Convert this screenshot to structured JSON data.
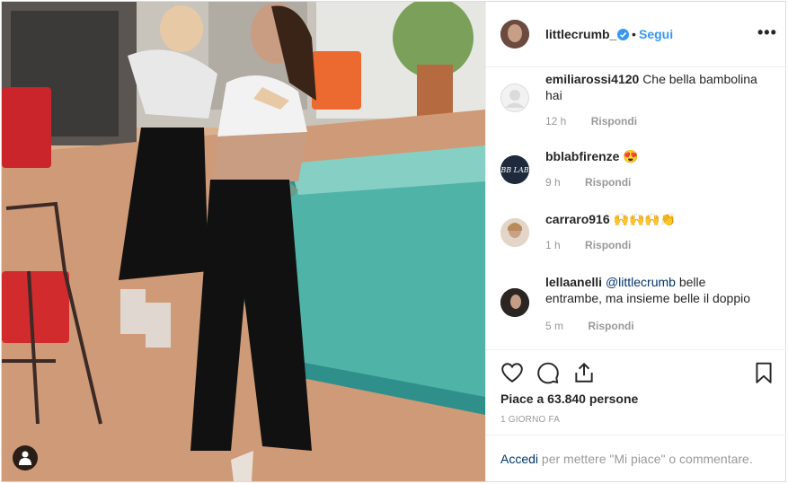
{
  "header": {
    "username": "littlecrumb_",
    "follow_label": "Segui",
    "dot": "•",
    "more_label": "•••"
  },
  "comments": [
    {
      "user": "emiliarossi4120",
      "text": "Che bella bambolina hai",
      "time": "12 h",
      "reply": "Rispondi"
    },
    {
      "user": "bblabfirenze",
      "text": "😍",
      "time": "9 h",
      "reply": "Rispondi"
    },
    {
      "user": "carraro916",
      "text": "🙌🙌🙌👏",
      "time": "1 h",
      "reply": "Rispondi"
    },
    {
      "user": "lellaanelli",
      "mention": "@littlecrumb",
      "text": " belle entrambe, ma insieme belle il doppio",
      "time": "5 m",
      "reply": "Rispondi"
    }
  ],
  "likes": "Piace a 63.840 persone",
  "posted_ago": "1 GIORNO FA",
  "login": {
    "link": "Accedi",
    "rest": " per mettere \"Mi piace\" o commentare."
  },
  "avatar_logo_text": "BB LAB",
  "colors": {
    "accent": "#3897f0",
    "link": "#003569",
    "muted": "#999999"
  }
}
